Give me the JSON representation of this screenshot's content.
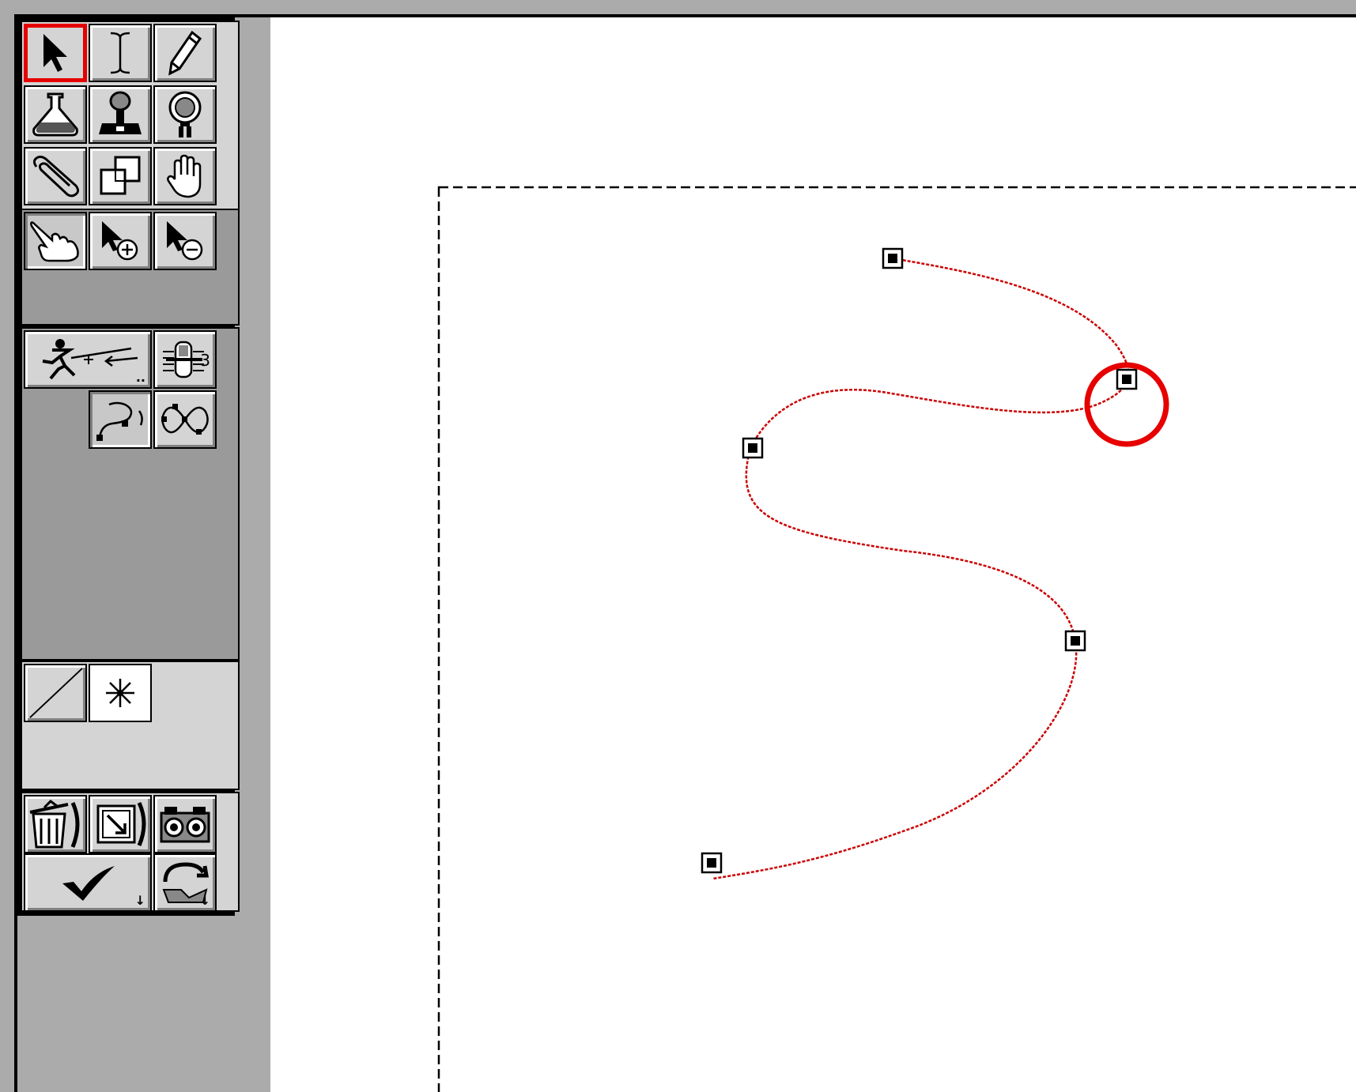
{
  "app": {
    "active_tool": "arrow",
    "accent_color": "#e60000",
    "path_color": "#cc0000"
  },
  "toolbox": {
    "top_tools": [
      {
        "id": "arrow",
        "icon": "arrow-pointer-icon",
        "selected": true
      },
      {
        "id": "text",
        "icon": "i-beam-icon",
        "selected": false
      },
      {
        "id": "pencil",
        "icon": "pencil-icon",
        "selected": false
      },
      {
        "id": "paint",
        "icon": "paint-bottle-icon",
        "selected": false
      },
      {
        "id": "stamp",
        "icon": "rubber-stamp-icon",
        "selected": false
      },
      {
        "id": "spray",
        "icon": "spray-can-icon",
        "selected": false
      },
      {
        "id": "clip",
        "icon": "paperclip-icon",
        "selected": false
      },
      {
        "id": "layers",
        "icon": "overlapping-squares-icon",
        "selected": false
      },
      {
        "id": "hand",
        "icon": "hand-icon",
        "selected": false
      }
    ],
    "path_tools": [
      {
        "id": "path-edit",
        "icon": "pointing-hand-icon",
        "pressed": true
      },
      {
        "id": "add-point",
        "icon": "arrow-plus-icon",
        "pressed": false
      },
      {
        "id": "remove-point",
        "icon": "arrow-minus-icon",
        "pressed": false
      }
    ],
    "motion_tools": [
      {
        "id": "animate-path",
        "icon": "running-man-icon",
        "has_submenu": true
      },
      {
        "id": "frame-counter",
        "icon": "film-frame-icon",
        "label": "3"
      }
    ],
    "curve_tools": [
      {
        "id": "open-curve",
        "icon": "open-curve-icon",
        "pressed": true
      },
      {
        "id": "closed-curve",
        "icon": "closed-loop-icon",
        "pressed": false
      }
    ],
    "line_tools": [
      {
        "id": "line",
        "icon": "diagonal-line-icon"
      },
      {
        "id": "sparkle",
        "icon": "sparkle-icon"
      }
    ],
    "action_tools": [
      {
        "id": "trash",
        "icon": "trash-can-icon"
      },
      {
        "id": "import",
        "icon": "import-icon"
      },
      {
        "id": "camera",
        "icon": "camera-icon"
      }
    ],
    "commit_tools": [
      {
        "id": "accept",
        "icon": "checkmark-icon",
        "has_submenu": true
      },
      {
        "id": "redo",
        "icon": "redo-arrow-icon",
        "has_submenu": true
      }
    ]
  },
  "path": {
    "anchor_count": 5,
    "highlighted_anchor_index": 1
  }
}
